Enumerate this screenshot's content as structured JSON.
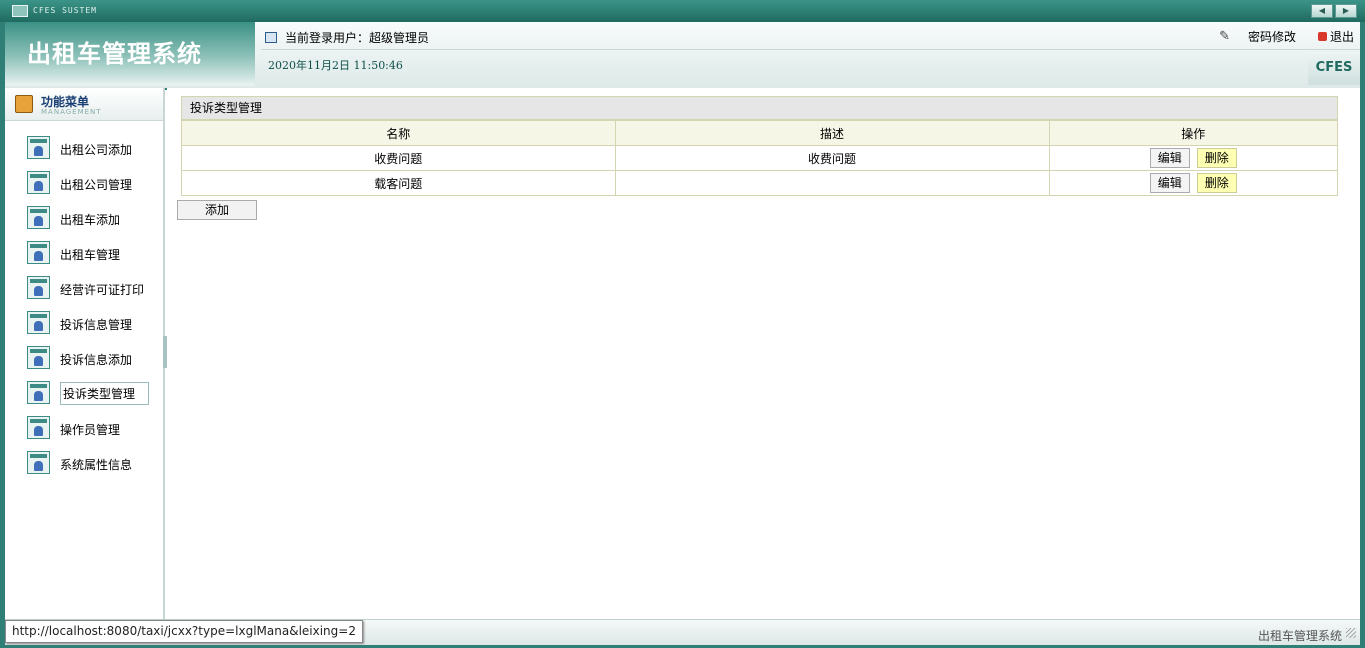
{
  "window": {
    "title": "CFES SUSTEM",
    "nav_prev": "◀",
    "nav_next": "▶"
  },
  "header": {
    "logo": "出租车管理系统",
    "user_label": "当前登录用户：超级管理员",
    "datetime": "2020年11月2日 11:50:46",
    "change_password": "密码修改",
    "logout": "退出",
    "badge": "CFES"
  },
  "sidebar": {
    "title": "功能菜单",
    "subtitle": "MANAGEMENT",
    "items": [
      {
        "label": "出租公司添加"
      },
      {
        "label": "出租公司管理"
      },
      {
        "label": "出租车添加"
      },
      {
        "label": "出租车管理"
      },
      {
        "label": "经营许可证打印"
      },
      {
        "label": "投诉信息管理"
      },
      {
        "label": "投诉信息添加"
      },
      {
        "label": "投诉类型管理",
        "active": true
      },
      {
        "label": "操作员管理"
      },
      {
        "label": "系统属性信息"
      }
    ]
  },
  "panel": {
    "title": "投诉类型管理",
    "columns": [
      "名称",
      "描述",
      "操作"
    ],
    "rows": [
      {
        "name": "收费问题",
        "desc": "收费问题",
        "edit": "编辑",
        "delete": "删除"
      },
      {
        "name": "载客问题",
        "desc": "",
        "edit": "编辑",
        "delete": "删除"
      }
    ],
    "add_label": "添加"
  },
  "statusbar": {
    "url": "http://localhost:8080/taxi/jcxx?type=lxglMana&leixing=2",
    "right_text": "出租车管理系统"
  }
}
